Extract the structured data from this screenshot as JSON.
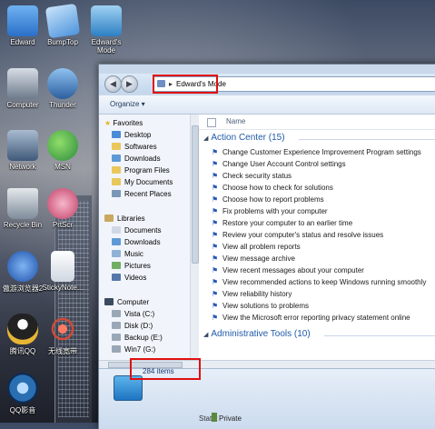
{
  "desktop": {
    "icons": [
      {
        "label": "Edward",
        "icon": "folder-icon",
        "color": "#3a8be0"
      },
      {
        "label": "BumpTop",
        "icon": "bumptop-icon",
        "color": "#5aa4e8"
      },
      {
        "label": "Edward's Mode",
        "icon": "control-panel-icon",
        "color": "#63a9df"
      },
      {
        "label": "Computer",
        "icon": "computer-icon",
        "color": "#8b98a8"
      },
      {
        "label": "Thunder",
        "icon": "thunder-icon",
        "color": "#3b6ea8"
      },
      {
        "label": "Network",
        "icon": "network-icon",
        "color": "#4e6f94"
      },
      {
        "label": "MSN",
        "icon": "msn-icon",
        "color": "#49a34e"
      },
      {
        "label": "Recycle Bin",
        "icon": "recycle-bin-icon",
        "color": "#7e8f9f"
      },
      {
        "label": "PrtScr",
        "icon": "prtscr-icon",
        "color": "#d4547b"
      },
      {
        "label": "傲游浏览器2",
        "icon": "maxthon-icon",
        "color": "#2b5fb8"
      },
      {
        "label": "StickyNote...",
        "icon": "document-icon",
        "color": "#e5e9ef"
      },
      {
        "label": "腾讯QQ",
        "icon": "qq-penguin-icon",
        "color": "#e6b431"
      },
      {
        "label": "无线宽带",
        "icon": "wireless-icon",
        "color": "#c83a2c"
      },
      {
        "label": "QQ影音",
        "icon": "qq-player-icon",
        "color": "#2a6fb1"
      }
    ]
  },
  "window": {
    "address_path": "Edward's Mode",
    "organize_label": "Organize ▾",
    "column_name": "Name",
    "nav": {
      "favorites": "Favorites",
      "fav_items": [
        "Desktop",
        "Softwares",
        "Downloads",
        "Program Files",
        "My Documents",
        "Recent Places"
      ],
      "libraries": "Libraries",
      "lib_items": [
        "Documents",
        "Downloads",
        "Music",
        "Pictures",
        "Videos"
      ],
      "computer": "Computer",
      "comp_items": [
        "Vista (C:)",
        "Disk (D:)",
        "Backup (E:)",
        "Win7 (G:)"
      ]
    },
    "groups": [
      {
        "title": "Action Center (15)",
        "items": [
          "Change Customer Experience Improvement Program settings",
          "Change User Account Control settings",
          "Check security status",
          "Choose how to check for solutions",
          "Choose how to report problems",
          "Fix problems with your computer",
          "Restore your computer to an earlier time",
          "Review your computer's status and resolve issues",
          "View all problem reports",
          "View message archive",
          "View recent messages about your computer",
          "View recommended actions to keep Windows running smoothly",
          "View reliability history",
          "View solutions to problems",
          "View the Microsoft error reporting privacy statement online"
        ]
      },
      {
        "title": "Administrative Tools (10)",
        "items": []
      }
    ],
    "details": {
      "item_count": "284 items",
      "state_label": "State:",
      "state_value": "Private"
    }
  },
  "colors": {
    "highlight_box": "#e01010",
    "group_title": "#1e5aa8"
  }
}
